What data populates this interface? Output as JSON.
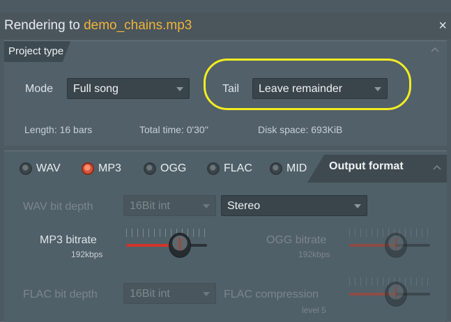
{
  "window": {
    "title_prefix": "Rendering to ",
    "file_name": "demo_chains.mp3",
    "close_glyph": "×"
  },
  "project_type": {
    "header": "Project type",
    "mode_label": "Mode",
    "mode_value": "Full song",
    "tail_label": "Tail",
    "tail_value": "Leave remainder",
    "length": "Length: 16 bars",
    "total_time": "Total time: 0'30''",
    "disk_space": "Disk space: 693KiB"
  },
  "formats": [
    {
      "label": "WAV",
      "selected": false
    },
    {
      "label": "MP3",
      "selected": true
    },
    {
      "label": "OGG",
      "selected": false
    },
    {
      "label": "FLAC",
      "selected": false
    },
    {
      "label": "MID",
      "selected": false
    }
  ],
  "output_format": {
    "header": "Output format",
    "wav_bit_depth_label": "WAV bit depth",
    "wav_bit_depth_value": "16Bit int",
    "channels_value": "Stereo",
    "mp3_bitrate_label": "MP3 bitrate",
    "mp3_bitrate_value": "192kbps",
    "mp3_bitrate_level": 0.72,
    "ogg_bitrate_label": "OGG bitrate",
    "ogg_bitrate_value": "192kbps",
    "ogg_bitrate_level": 0.6,
    "flac_bit_depth_label": "FLAC bit depth",
    "flac_bit_depth_value": "16Bit int",
    "flac_compression_label": "FLAC compression",
    "flac_compression_value": "level 5",
    "flac_compression_level": 0.6
  },
  "colors": {
    "accent_file": "#f0b43b",
    "annotation": "#f3ee1f",
    "knob_fill": "#d2352b"
  }
}
